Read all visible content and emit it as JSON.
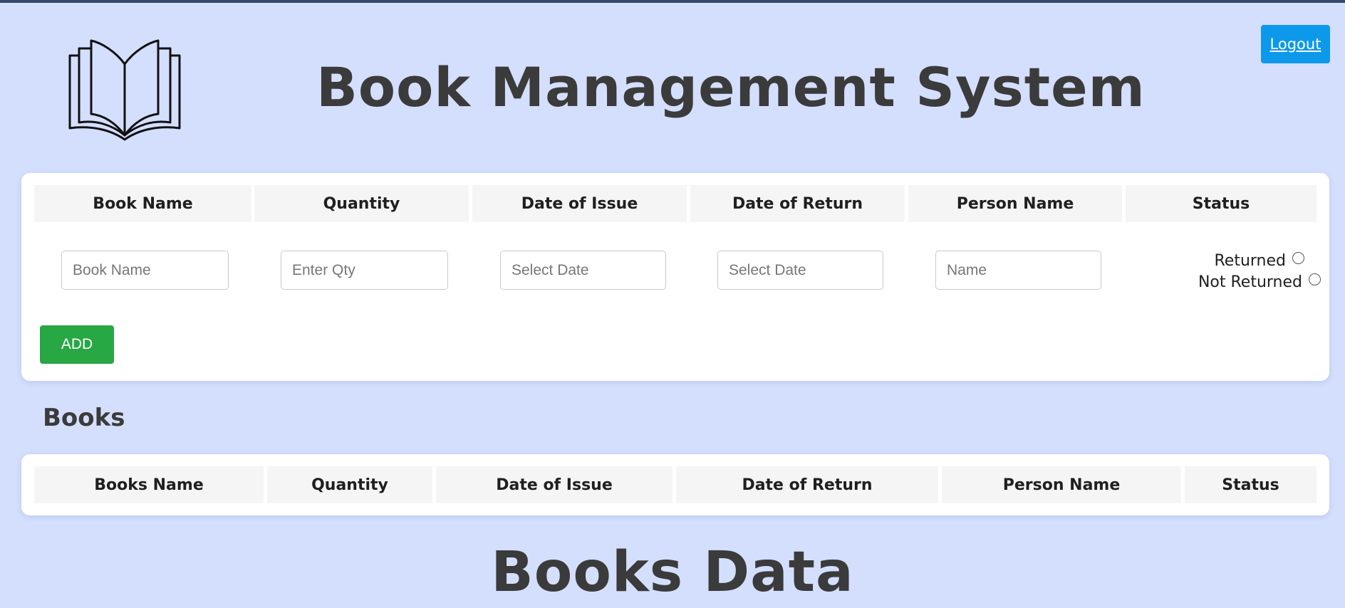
{
  "header": {
    "title": "Book Management System",
    "logout_label": "Logout"
  },
  "form": {
    "columns": [
      "Book Name",
      "Quantity",
      "Date of Issue",
      "Date of Return",
      "Person Name",
      "Status"
    ],
    "placeholders": {
      "book_name": "Book Name",
      "quantity": "Enter Qty",
      "date_of_issue": "Select Date",
      "date_of_return": "Select Date",
      "person_name": "Name"
    },
    "status_options": [
      "Returned",
      "Not Returned"
    ],
    "add_label": "ADD"
  },
  "books_section": {
    "heading": "Books",
    "columns": [
      "Books Name",
      "Quantity",
      "Date of Issue",
      "Date of Return",
      "Person Name",
      "Status"
    ]
  },
  "books_data": {
    "heading": "Books Data"
  },
  "colors": {
    "background": "#d4dffe",
    "logout": "#0d99ea",
    "add": "#28a745"
  }
}
